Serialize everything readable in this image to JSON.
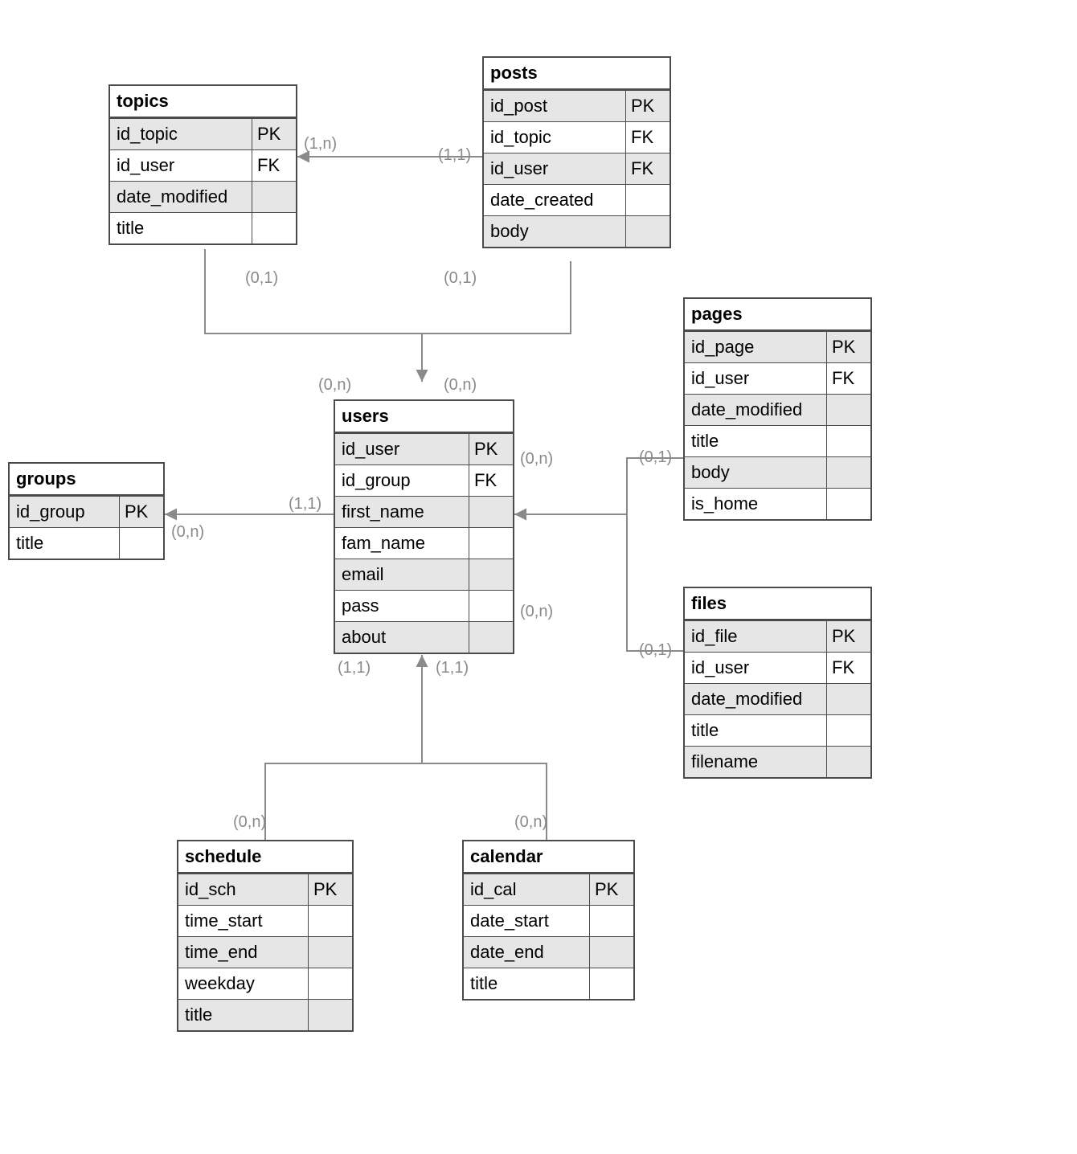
{
  "colors": {
    "border": "#4b4b4b",
    "shade": "#e6e6e6",
    "connector": "#8a8a8a",
    "cardinality": "#8a8a8a"
  },
  "entities": {
    "topics": {
      "title": "topics",
      "rows": [
        {
          "name": "id_topic",
          "key": "PK"
        },
        {
          "name": "id_user",
          "key": "FK"
        },
        {
          "name": "date_modified",
          "key": ""
        },
        {
          "name": "title",
          "key": ""
        }
      ]
    },
    "posts": {
      "title": "posts",
      "rows": [
        {
          "name": "id_post",
          "key": "PK"
        },
        {
          "name": "id_topic",
          "key": "FK"
        },
        {
          "name": "id_user",
          "key": "FK"
        },
        {
          "name": "date_created",
          "key": ""
        },
        {
          "name": "body",
          "key": ""
        }
      ]
    },
    "pages": {
      "title": "pages",
      "rows": [
        {
          "name": "id_page",
          "key": "PK"
        },
        {
          "name": "id_user",
          "key": "FK"
        },
        {
          "name": "date_modified",
          "key": ""
        },
        {
          "name": "title",
          "key": ""
        },
        {
          "name": "body",
          "key": ""
        },
        {
          "name": "is_home",
          "key": ""
        }
      ]
    },
    "users": {
      "title": "users",
      "rows": [
        {
          "name": "id_user",
          "key": "PK"
        },
        {
          "name": "id_group",
          "key": "FK"
        },
        {
          "name": "first_name",
          "key": ""
        },
        {
          "name": "fam_name",
          "key": ""
        },
        {
          "name": "email",
          "key": ""
        },
        {
          "name": "pass",
          "key": ""
        },
        {
          "name": "about",
          "key": ""
        }
      ]
    },
    "groups": {
      "title": "groups",
      "rows": [
        {
          "name": "id_group",
          "key": "PK"
        },
        {
          "name": "title",
          "key": ""
        }
      ]
    },
    "files": {
      "title": "files",
      "rows": [
        {
          "name": "id_file",
          "key": "PK"
        },
        {
          "name": "id_user",
          "key": "FK"
        },
        {
          "name": "date_modified",
          "key": ""
        },
        {
          "name": "title",
          "key": ""
        },
        {
          "name": "filename",
          "key": ""
        }
      ]
    },
    "schedule": {
      "title": "schedule",
      "rows": [
        {
          "name": "id_sch",
          "key": "PK"
        },
        {
          "name": "time_start",
          "key": ""
        },
        {
          "name": "time_end",
          "key": ""
        },
        {
          "name": "weekday",
          "key": ""
        },
        {
          "name": "title",
          "key": ""
        }
      ]
    },
    "calendar": {
      "title": "calendar",
      "rows": [
        {
          "name": "id_cal",
          "key": "PK"
        },
        {
          "name": "date_start",
          "key": ""
        },
        {
          "name": "date_end",
          "key": ""
        },
        {
          "name": "title",
          "key": ""
        }
      ]
    }
  },
  "cardinalities": {
    "posts_to_topics_left": "(1,1)",
    "posts_to_topics_right": "(1,n)",
    "topics_to_users": "(0,1)",
    "posts_to_users": "(0,1)",
    "users_top_left": "(0,n)",
    "users_top_right": "(0,n)",
    "users_to_groups_left": "(1,1)",
    "users_to_groups_right": "(0,n)",
    "users_right_upper": "(0,n)",
    "users_right_lower": "(0,n)",
    "pages_side": "(0,1)",
    "files_side": "(0,1)",
    "users_bottom_left": "(1,1)",
    "users_bottom_right": "(1,1)",
    "schedule_top": "(0,n)",
    "calendar_top": "(0,n)"
  }
}
